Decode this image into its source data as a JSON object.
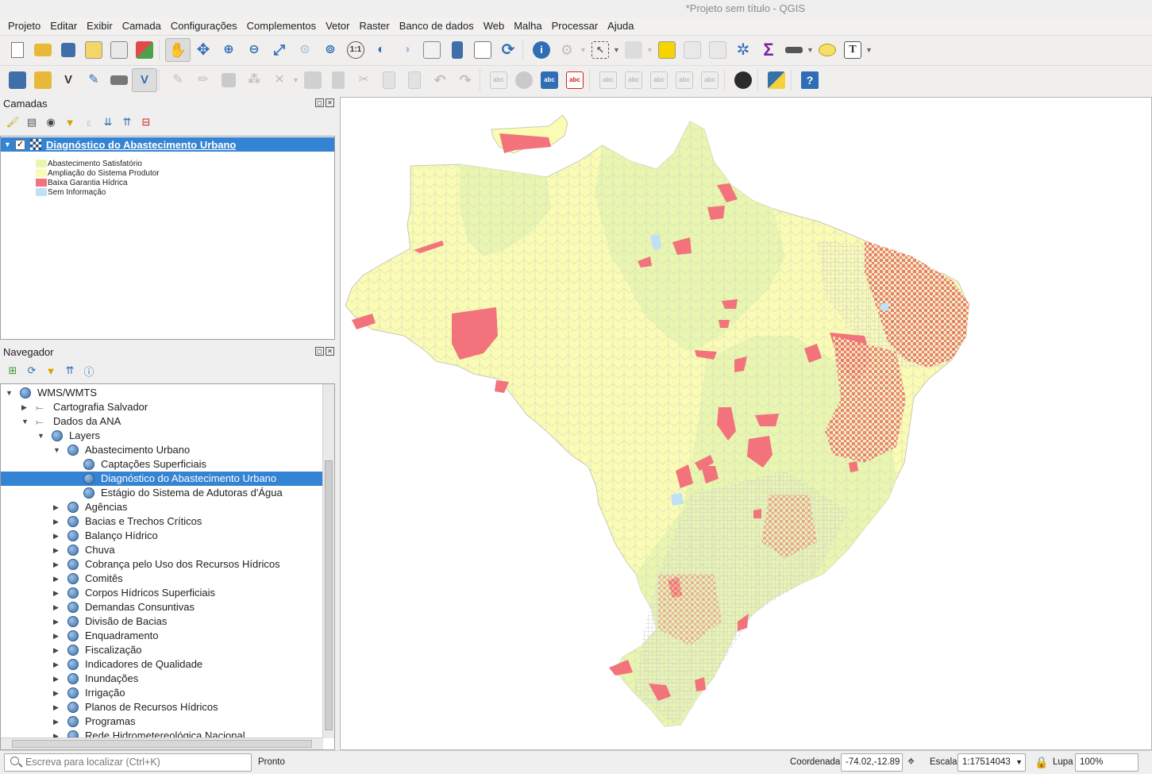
{
  "window": {
    "title": "*Projeto sem título - QGIS"
  },
  "menu": [
    "Projeto",
    "Editar",
    "Exibir",
    "Camada",
    "Configurações",
    "Complementos",
    "Vetor",
    "Raster",
    "Banco de dados",
    "Web",
    "Malha",
    "Processar",
    "Ajuda"
  ],
  "layers_panel": {
    "title": "Camadas",
    "layer_name": "Diagnóstico do Abastecimento Urbano",
    "legend": [
      {
        "label": "Abastecimento Satisfatório",
        "color": "#e8f6b0"
      },
      {
        "label": "Ampliação do Sistema Produtor",
        "color": "#fafcb4"
      },
      {
        "label": "Baixa Garantia Hídrica",
        "color": "#f2737c"
      },
      {
        "label": "Sem Informação",
        "color": "#bfe0f5"
      }
    ]
  },
  "browser_panel": {
    "title": "Navegador",
    "tree": [
      {
        "label": "WMS/WMTS",
        "expanded": true,
        "icon": "globe-icon"
      },
      {
        "label": "Cartografia Salvador",
        "expanded": false,
        "icon": "connection-icon"
      },
      {
        "label": "Dados da ANA",
        "expanded": true,
        "icon": "connection-icon"
      },
      {
        "label": "Layers",
        "expanded": true,
        "icon": "globe-icon"
      },
      {
        "label": "Abastecimento Urbano",
        "expanded": true,
        "icon": "globe-icon"
      },
      {
        "label": "Captações Superficiais",
        "icon": "globe-icon"
      },
      {
        "label": "Diagnóstico do Abastecimento Urbano",
        "icon": "globe-icon",
        "selected": true
      },
      {
        "label": "Estágio do Sistema de Adutoras d'Água",
        "icon": "globe-icon"
      },
      {
        "label": "Agências",
        "expanded": false,
        "icon": "globe-icon"
      },
      {
        "label": "Bacias e Trechos Críticos",
        "expanded": false,
        "icon": "globe-icon"
      },
      {
        "label": "Balanço Hídrico",
        "expanded": false,
        "icon": "globe-icon"
      },
      {
        "label": "Chuva",
        "expanded": false,
        "icon": "globe-icon"
      },
      {
        "label": "Cobrança pelo Uso dos Recursos Hídricos",
        "expanded": false,
        "icon": "globe-icon"
      },
      {
        "label": "Comitês",
        "expanded": false,
        "icon": "globe-icon"
      },
      {
        "label": "Corpos Hídricos Superficiais",
        "expanded": false,
        "icon": "globe-icon"
      },
      {
        "label": "Demandas Consuntivas",
        "expanded": false,
        "icon": "globe-icon"
      },
      {
        "label": "Divisão de Bacias",
        "expanded": false,
        "icon": "globe-icon"
      },
      {
        "label": "Enquadramento",
        "expanded": false,
        "icon": "globe-icon"
      },
      {
        "label": "Fiscalização",
        "expanded": false,
        "icon": "globe-icon"
      },
      {
        "label": "Indicadores de Qualidade",
        "expanded": false,
        "icon": "globe-icon"
      },
      {
        "label": "Inundações",
        "expanded": false,
        "icon": "globe-icon"
      },
      {
        "label": "Irrigação",
        "expanded": false,
        "icon": "globe-icon"
      },
      {
        "label": "Planos de Recursos Hídricos",
        "expanded": false,
        "icon": "globe-icon"
      },
      {
        "label": "Programas",
        "expanded": false,
        "icon": "globe-icon"
      },
      {
        "label": "Rede Hidrometereológica Nacional",
        "expanded": false,
        "icon": "globe-icon"
      }
    ]
  },
  "toolbar": {
    "abc_label": "abc",
    "text_tool_glyph": "T",
    "sum_glyph": "Σ",
    "help_glyph": "?"
  },
  "statusbar": {
    "locator_placeholder": "Escreva para localizar (Ctrl+K)",
    "status": "Pronto",
    "coord_label": "Coordenada",
    "coord_value": "-74.02,-12.89",
    "scale_label": "Escala",
    "scale_value": "1:17514043",
    "magnifier_label": "Lupa",
    "magnifier_value": "100%"
  },
  "colors": {
    "satisfatorio": "#e8f6b0",
    "ampliacao": "#fafcb4",
    "baixa_garantia": "#f2737c",
    "sem_info": "#bfe0f5",
    "selection": "#3584d3"
  }
}
